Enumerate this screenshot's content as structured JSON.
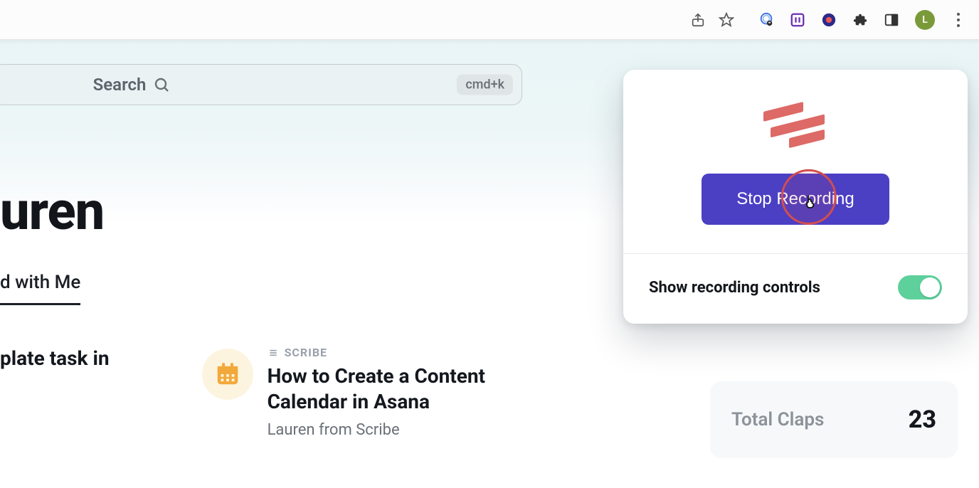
{
  "browser": {
    "avatar_initial": "L"
  },
  "search": {
    "placeholder": "Search",
    "shortcut": "cmd+k"
  },
  "page": {
    "title_fragment": "uren"
  },
  "tabs": {
    "shared_fragment": "d with Me"
  },
  "cards": [
    {
      "type_label": "",
      "title_fragment": "plate task in",
      "author": ""
    },
    {
      "type_label": "SCRIBE",
      "title": "How to Create a Content Calendar in Asana",
      "author": "Lauren from Scribe"
    }
  ],
  "stats": {
    "label": "Total Claps",
    "value": "23"
  },
  "extension_popup": {
    "button_label": "Stop Recording",
    "controls_label": "Show recording controls",
    "toggle_on": true
  }
}
